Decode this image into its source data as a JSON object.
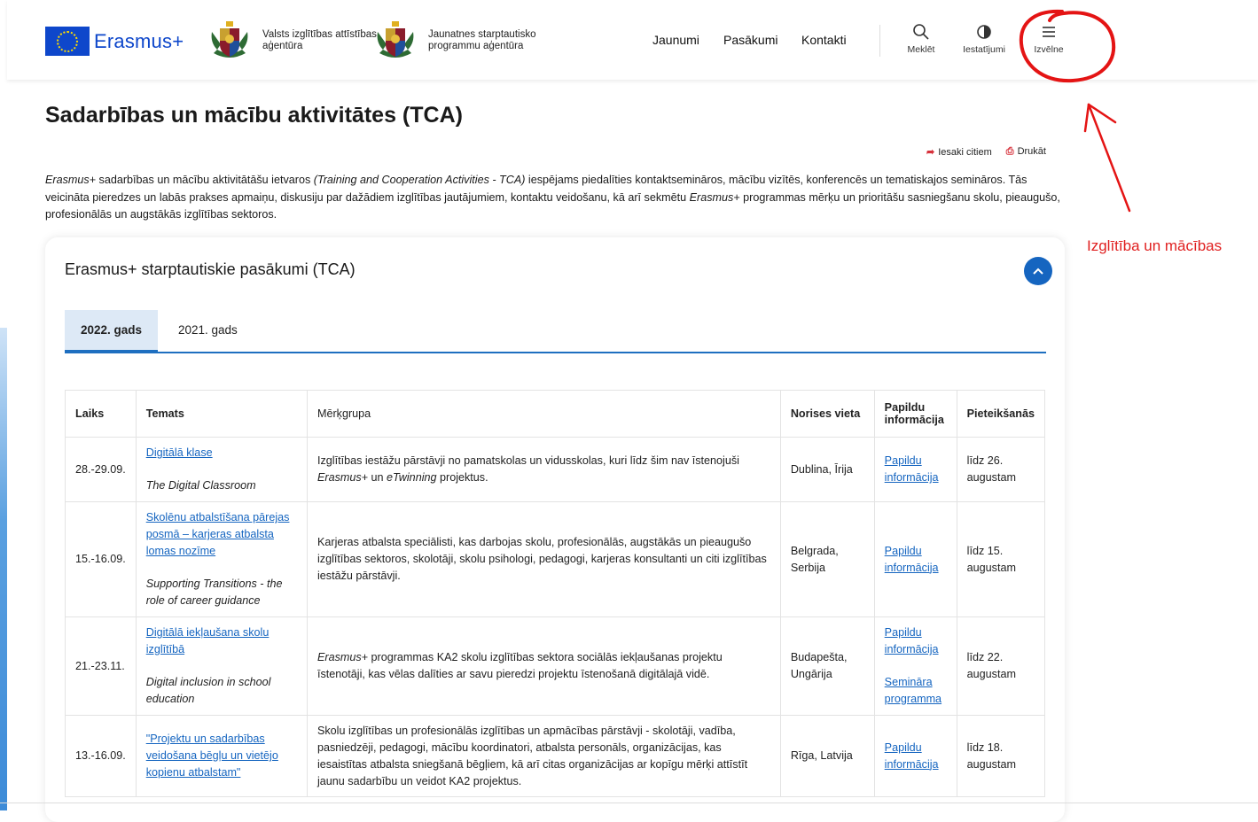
{
  "header": {
    "brand_text": "Erasmus+",
    "agency1": "Valsts izglītības attīstības aģentūra",
    "agency2": "Jaunatnes starptautisko programmu aģentūra",
    "nav": [
      "Jaunumi",
      "Pasākumi",
      "Kontakti"
    ],
    "search_label": "Meklēt",
    "settings_label": "Iestatījumi",
    "menu_label": "Izvēlne"
  },
  "annotation": {
    "note": "Izglītība un mācības"
  },
  "page": {
    "title": "Sadarbības un mācību aktivitātes (TCA)",
    "share": "Iesaki citiem",
    "print": "Drukāt",
    "intro": {
      "p1_em": "Erasmus+",
      "p1_a": " sadarbības un mācību aktivitātāšu ietvaros ",
      "p1_em2": "(Training and Cooperation Activities - TCA)",
      "p1_b": " iespējams piedalīties kontaktsemināros, mācību vizītēs, konferencēs un tematiskajos semināros. Tās veicināta pieredzes un labās prakses apmaiņu, diskusiju par dažādiem izglītības jautājumiem, kontaktu veidošanu, kā arī sekmētu ",
      "p1_em3": "Erasmus+",
      "p1_c": " programmas mērķu un prioritāšu sasniegšanu skolu, pieaugušo, profesionālās un augstākās izglītības sektoros."
    }
  },
  "card": {
    "title": "Erasmus+ starptautiskie pasākumi (TCA)",
    "tabs": [
      "2022. gads",
      "2021. gads"
    ],
    "columns": [
      "Laiks",
      "Temats",
      "Mērķgrupa",
      "Norises vieta",
      "Papildu informācija",
      "Pieteikšanās"
    ],
    "rows": [
      {
        "time": "28.-29.09.",
        "topic": "Digitālā klase",
        "topic_en": "The Digital Classroom",
        "target_pre": "Izglītības iestāžu pārstāvji no pamatskolas un vidusskolas, kuri līdz šim nav īstenojuši ",
        "target_em": "Erasmus+",
        "target_mid": " un ",
        "target_em2": "eTwinning",
        "target_post": " projektus.",
        "place": "Dublina, Īrija",
        "info": "Papildu informācija",
        "deadline": "līdz 26. augustam"
      },
      {
        "time": "15.-16.09.",
        "topic": "Skolēnu atbalstīšana pārejas posmā – karjeras atbalsta lomas nozīme",
        "topic_en": "Supporting Transitions - the role of career guidance",
        "target": "Karjeras atbalsta speciālisti, kas darbojas skolu, profesionālās, augstākās un pieaugušo izglītības sektoros, skolotāji, skolu psihologi, pedagogi, karjeras konsultanti un citi izglītības iestāžu pārstāvji.",
        "place": "Belgrada, Serbija",
        "info": "Papildu informācija",
        "deadline": "līdz 15. augustam"
      },
      {
        "time": "21.-23.11.",
        "topic": "Digitālā iekļaušana skolu izglītībā",
        "topic_en": "Digital inclusion in school education",
        "target_em": "Erasmus+",
        "target_rest": " programmas KA2 skolu izglītības sektora sociālās iekļaušanas projektu īstenotāji, kas vēlas dalīties ar savu pieredzi projektu īstenošanā digitālajā vidē.",
        "place": "Budapešta, Ungārija",
        "info": "Papildu informācija",
        "info2": "Semināra programma",
        "deadline": "līdz 22. augustam"
      },
      {
        "time": "13.-16.09.",
        "topic": "\"Projektu un sadarbības veidošana bēgļu un vietējo kopienu atbalstam\"",
        "target": "Skolu izglītības un profesionālās izglītības un apmācības pārstāvji - skolotāji, vadība, pasniedzēji, pedagogi, mācību koordinatori, atbalsta personāls, organizācijas, kas iesaistītas atbalsta sniegšanā bēgļiem, kā arī citas organizācijas ar kopīgu mērķi attīstīt jaunu sadarbību un veidot KA2 projektus.",
        "place": "Rīga, Latvija",
        "info": "Papildu informācija",
        "deadline": "līdz 18. augustam"
      }
    ]
  },
  "colors": {
    "brand_blue": "#0e47cb",
    "link_blue": "#1565c0",
    "annotation_red": "#e02020"
  },
  "icons": [
    "search-icon",
    "contrast-icon",
    "hamburger-icon",
    "share-icon",
    "print-icon",
    "chevron-up-icon"
  ]
}
